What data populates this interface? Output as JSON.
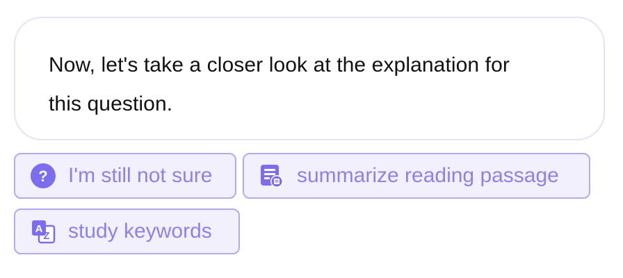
{
  "message": {
    "line1": "Now, let's take a closer look at the explanation for",
    "line2": "this question."
  },
  "suggestions": [
    {
      "label": "I'm still not sure",
      "icon": "question-circle-icon"
    },
    {
      "label": "summarize reading passage",
      "icon": "document-summary-icon"
    },
    {
      "label": "study keywords",
      "icon": "translate-az-icon"
    }
  ],
  "colors": {
    "accent": "#7b6cf0",
    "chip_text": "#8d82ec",
    "chip_border": "#b3aaf0",
    "chip_bg": "#f2f0fc",
    "bubble_border": "#e4e2f7"
  }
}
